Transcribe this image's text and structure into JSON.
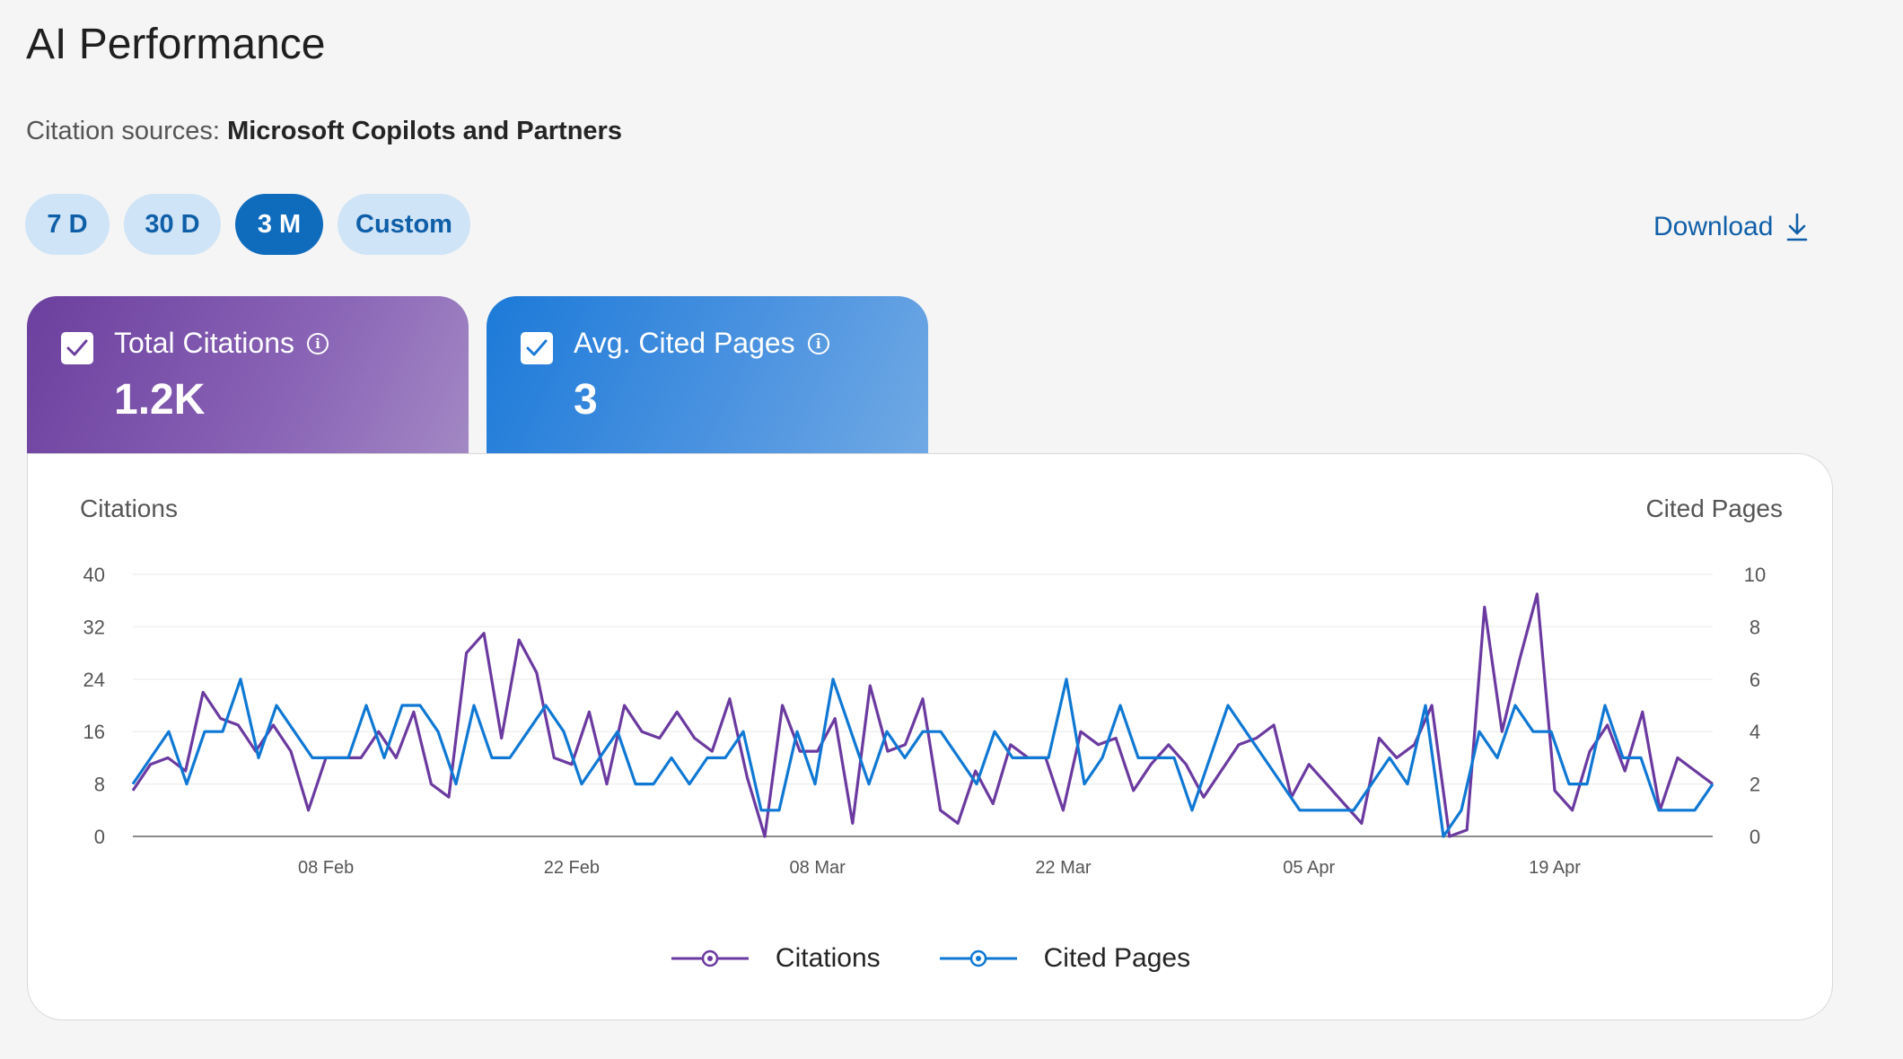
{
  "page": {
    "title": "AI Performance",
    "sources_label": "Citation sources:",
    "sources_value": "Microsoft Copilots and Partners"
  },
  "ranges": [
    {
      "label": "7 D",
      "active": false
    },
    {
      "label": "30 D",
      "active": false
    },
    {
      "label": "3 M",
      "active": true
    },
    {
      "label": "Custom",
      "active": false
    }
  ],
  "download": {
    "label": "Download",
    "icon": "download-arrow-icon"
  },
  "cards": [
    {
      "label": "Total Citations",
      "value": "1.2K",
      "checked": true,
      "color": "#6b3f9e",
      "icon": "info-icon"
    },
    {
      "label": "Avg. Cited Pages",
      "value": "3",
      "checked": true,
      "color": "#1c7ad8",
      "icon": "info-icon"
    }
  ],
  "colors": {
    "citations": "#6b3aa0",
    "cited_pages": "#0f78d4",
    "accent": "#0f6cbd"
  },
  "chart_data": {
    "type": "line",
    "ylabel_left": "Citations",
    "ylabel_right": "Cited Pages",
    "y_left_ticks": [
      0,
      8,
      16,
      24,
      32,
      40
    ],
    "y_right_ticks": [
      0,
      2,
      4,
      6,
      8,
      10
    ],
    "ylim_left": [
      0,
      40
    ],
    "ylim_right": [
      0,
      10
    ],
    "x_tick_labels": [
      "08 Feb",
      "22 Feb",
      "08 Mar",
      "22 Mar",
      "05 Apr",
      "19 Apr"
    ],
    "x_tick_index": [
      11,
      25,
      39,
      53,
      67,
      81
    ],
    "grid": true,
    "legend_position": "bottom",
    "series": [
      {
        "name": "Citations",
        "axis": "left",
        "color": "#6b3aa0",
        "values": [
          7,
          11,
          12,
          10,
          22,
          18,
          17,
          13,
          17,
          13,
          4,
          12,
          12,
          12,
          16,
          12,
          19,
          8,
          6,
          28,
          31,
          15,
          30,
          25,
          12,
          11,
          19,
          8,
          20,
          16,
          15,
          19,
          15,
          13,
          21,
          9,
          0,
          20,
          13,
          13,
          18,
          2,
          23,
          13,
          14,
          21,
          4,
          2,
          10,
          5,
          14,
          12,
          12,
          4,
          16,
          14,
          15,
          7,
          11,
          14,
          11,
          6,
          10,
          14,
          15,
          17,
          6,
          11,
          8,
          5,
          2,
          15,
          12,
          14,
          20,
          0,
          1,
          35,
          16,
          27,
          37,
          7,
          4,
          13,
          17,
          10,
          19,
          4,
          12,
          10,
          8
        ]
      },
      {
        "name": "Cited Pages",
        "axis": "right",
        "color": "#0f78d4",
        "values": [
          2,
          3,
          4,
          2,
          4,
          4,
          6,
          3,
          5,
          4,
          3,
          3,
          3,
          5,
          3,
          5,
          5,
          4,
          2,
          5,
          3,
          3,
          4,
          5,
          4,
          2,
          3,
          4,
          2,
          2,
          3,
          2,
          3,
          3,
          4,
          1,
          1,
          4,
          2,
          6,
          4,
          2,
          4,
          3,
          4,
          4,
          3,
          2,
          4,
          3,
          3,
          3,
          6,
          2,
          3,
          5,
          3,
          3,
          3,
          1,
          3,
          5,
          4,
          3,
          2,
          1,
          1,
          1,
          1,
          2,
          3,
          2,
          5,
          0,
          1,
          4,
          3,
          5,
          4,
          4,
          2,
          2,
          5,
          3,
          3,
          1,
          1,
          1,
          2
        ]
      }
    ]
  }
}
